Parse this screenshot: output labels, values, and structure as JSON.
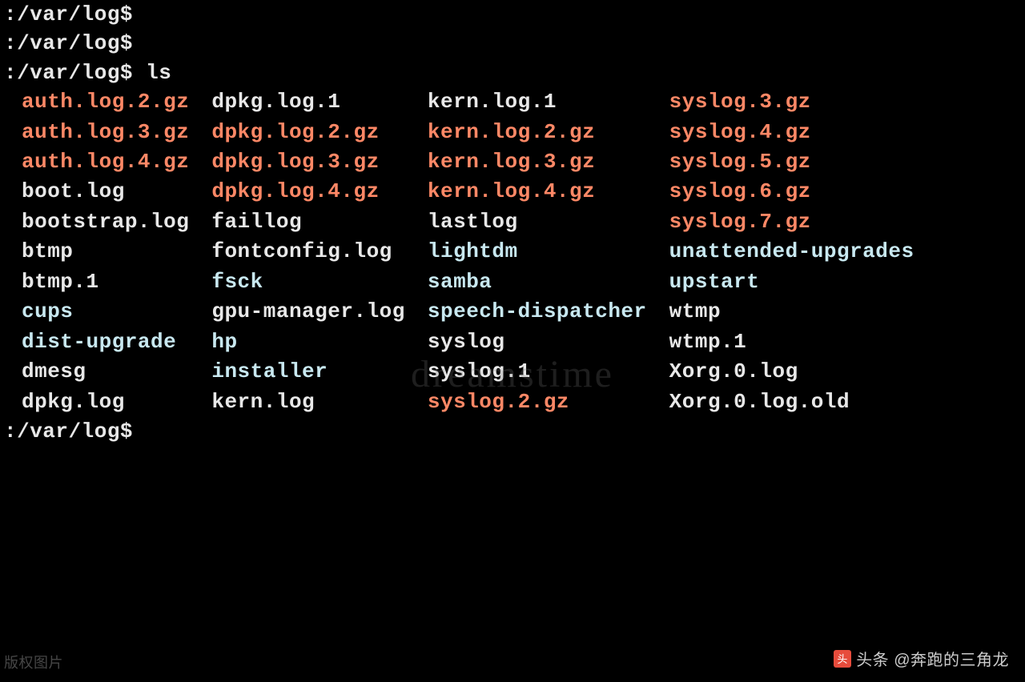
{
  "prompts": {
    "line1": ":/var/log$",
    "line2": ":/var/log$",
    "line3": ":/var/log$ ls",
    "line4": ":/var/log$"
  },
  "listing": {
    "col1": [
      {
        "name": "auth.log.2.gz",
        "type": "compressed"
      },
      {
        "name": "auth.log.3.gz",
        "type": "compressed"
      },
      {
        "name": "auth.log.4.gz",
        "type": "compressed"
      },
      {
        "name": "boot.log",
        "type": "file"
      },
      {
        "name": "bootstrap.log",
        "type": "file"
      },
      {
        "name": "btmp",
        "type": "file"
      },
      {
        "name": "btmp.1",
        "type": "file"
      },
      {
        "name": "cups",
        "type": "directory"
      },
      {
        "name": "dist-upgrade",
        "type": "directory"
      },
      {
        "name": "dmesg",
        "type": "file"
      },
      {
        "name": "dpkg.log",
        "type": "file"
      }
    ],
    "col2": [
      {
        "name": "dpkg.log.1",
        "type": "file"
      },
      {
        "name": "dpkg.log.2.gz",
        "type": "compressed"
      },
      {
        "name": "dpkg.log.3.gz",
        "type": "compressed"
      },
      {
        "name": "dpkg.log.4.gz",
        "type": "compressed"
      },
      {
        "name": "faillog",
        "type": "file"
      },
      {
        "name": "fontconfig.log",
        "type": "file"
      },
      {
        "name": "fsck",
        "type": "directory"
      },
      {
        "name": "gpu-manager.log",
        "type": "file"
      },
      {
        "name": "hp",
        "type": "directory"
      },
      {
        "name": "installer",
        "type": "directory"
      },
      {
        "name": "kern.log",
        "type": "file"
      }
    ],
    "col3": [
      {
        "name": "kern.log.1",
        "type": "file"
      },
      {
        "name": "kern.log.2.gz",
        "type": "compressed"
      },
      {
        "name": "kern.log.3.gz",
        "type": "compressed"
      },
      {
        "name": "kern.log.4.gz",
        "type": "compressed"
      },
      {
        "name": "lastlog",
        "type": "file"
      },
      {
        "name": "lightdm",
        "type": "directory"
      },
      {
        "name": "samba",
        "type": "directory"
      },
      {
        "name": "speech-dispatcher",
        "type": "directory"
      },
      {
        "name": "syslog",
        "type": "file"
      },
      {
        "name": "syslog.1",
        "type": "file"
      },
      {
        "name": "syslog.2.gz",
        "type": "compressed"
      }
    ],
    "col4": [
      {
        "name": "syslog.3.gz",
        "type": "compressed"
      },
      {
        "name": "syslog.4.gz",
        "type": "compressed"
      },
      {
        "name": "syslog.5.gz",
        "type": "compressed"
      },
      {
        "name": "syslog.6.gz",
        "type": "compressed"
      },
      {
        "name": "syslog.7.gz",
        "type": "compressed"
      },
      {
        "name": "unattended-upgrades",
        "type": "directory"
      },
      {
        "name": "upstart",
        "type": "directory"
      },
      {
        "name": "wtmp",
        "type": "file"
      },
      {
        "name": "wtmp.1",
        "type": "file"
      },
      {
        "name": "Xorg.0.log",
        "type": "file"
      },
      {
        "name": "Xorg.0.log.old",
        "type": "file"
      }
    ]
  },
  "watermark": "dreamstime",
  "footer": {
    "left": "版权图片",
    "right_label": "头条",
    "right_author": "@奔跑的三角龙",
    "icon_text": "头"
  }
}
